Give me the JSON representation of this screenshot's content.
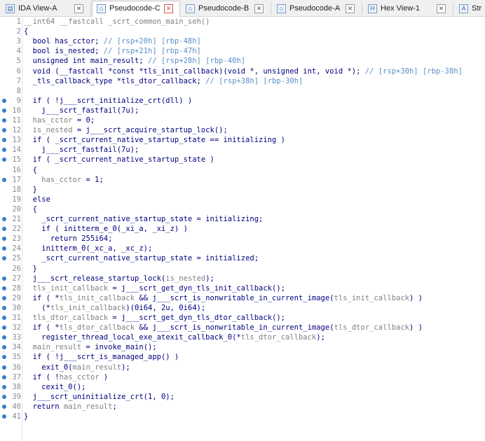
{
  "tabs": [
    {
      "label": "IDA View-A",
      "icon": "ida-view-icon",
      "active": false
    },
    {
      "label": "Pseudocode-C",
      "icon": "pseudocode-icon",
      "active": true
    },
    {
      "label": "Pseudocode-B",
      "icon": "pseudocode-icon",
      "active": false
    },
    {
      "label": "Pseudocode-A",
      "icon": "pseudocode-icon",
      "active": false
    },
    {
      "label": "Hex View-1",
      "icon": "hex-view-icon",
      "active": false
    },
    {
      "label": "Str",
      "icon": "structures-icon",
      "active": false
    }
  ],
  "close_glyph": "✕",
  "colors": {
    "code": "#000080",
    "variable": "#808080",
    "comment": "#5b8ec8",
    "line_number": "#8a8a8a",
    "breakpoint": "#2f7fd1"
  },
  "lines": [
    {
      "n": "1",
      "bp": false,
      "tokens": [
        [
          "h",
          "__int64 __fastcall _scrt_common_main_seh()"
        ]
      ]
    },
    {
      "n": "2",
      "bp": false,
      "tokens": [
        [
          "t",
          "{"
        ]
      ]
    },
    {
      "n": "3",
      "bp": false,
      "tokens": [
        [
          "t",
          "  bool has_cctor; "
        ],
        [
          "c",
          "// [rsp+20h] [rbp-48h]"
        ]
      ]
    },
    {
      "n": "4",
      "bp": false,
      "tokens": [
        [
          "t",
          "  bool is_nested; "
        ],
        [
          "c",
          "// [rsp+21h] [rbp-47h]"
        ]
      ]
    },
    {
      "n": "5",
      "bp": false,
      "tokens": [
        [
          "t",
          "  unsigned int main_result; "
        ],
        [
          "c",
          "// [rsp+28h] [rbp-40h]"
        ]
      ]
    },
    {
      "n": "6",
      "bp": false,
      "tokens": [
        [
          "t",
          "  void (__fastcall *const *tls_init_callback)(void *, unsigned int, void *); "
        ],
        [
          "c",
          "// [rsp+30h] [rbp-38h]"
        ]
      ]
    },
    {
      "n": "7",
      "bp": false,
      "tokens": [
        [
          "t",
          "  _tls_callback_type *tls_dtor_callback; "
        ],
        [
          "c",
          "// [rsp+38h] [rbp-30h]"
        ]
      ]
    },
    {
      "n": "8",
      "bp": false,
      "tokens": [
        [
          "t",
          ""
        ]
      ]
    },
    {
      "n": "9",
      "bp": true,
      "tokens": [
        [
          "t",
          "  if ( !j___scrt_initialize_crt(dll) )"
        ]
      ]
    },
    {
      "n": "10",
      "bp": true,
      "tokens": [
        [
          "t",
          "    j___scrt_fastfail(7u);"
        ]
      ]
    },
    {
      "n": "11",
      "bp": true,
      "tokens": [
        [
          "v",
          "  has_cctor"
        ],
        [
          "t",
          " = 0;"
        ]
      ]
    },
    {
      "n": "12",
      "bp": true,
      "tokens": [
        [
          "v",
          "  is_nested"
        ],
        [
          "t",
          " = j___scrt_acquire_startup_lock();"
        ]
      ]
    },
    {
      "n": "13",
      "bp": true,
      "tokens": [
        [
          "t",
          "  if ( _scrt_current_native_startup_state == initializing )"
        ]
      ]
    },
    {
      "n": "14",
      "bp": true,
      "tokens": [
        [
          "t",
          "    j___scrt_fastfail(7u);"
        ]
      ]
    },
    {
      "n": "15",
      "bp": true,
      "tokens": [
        [
          "t",
          "  if ( _scrt_current_native_startup_state )"
        ]
      ]
    },
    {
      "n": "16",
      "bp": false,
      "tokens": [
        [
          "t",
          "  {"
        ]
      ]
    },
    {
      "n": "17",
      "bp": true,
      "tokens": [
        [
          "v",
          "    has_cctor"
        ],
        [
          "t",
          " = 1;"
        ]
      ]
    },
    {
      "n": "18",
      "bp": false,
      "tokens": [
        [
          "t",
          "  }"
        ]
      ]
    },
    {
      "n": "19",
      "bp": false,
      "tokens": [
        [
          "t",
          "  else"
        ]
      ]
    },
    {
      "n": "20",
      "bp": false,
      "tokens": [
        [
          "t",
          "  {"
        ]
      ]
    },
    {
      "n": "21",
      "bp": true,
      "tokens": [
        [
          "t",
          "    _scrt_current_native_startup_state = initializing;"
        ]
      ]
    },
    {
      "n": "22",
      "bp": true,
      "tokens": [
        [
          "t",
          "    if ( initterm_e_0(_xi_a, _xi_z) )"
        ]
      ]
    },
    {
      "n": "23",
      "bp": true,
      "tokens": [
        [
          "t",
          "      return 255i64;"
        ]
      ]
    },
    {
      "n": "24",
      "bp": true,
      "tokens": [
        [
          "t",
          "    initterm_0(_xc_a, _xc_z);"
        ]
      ]
    },
    {
      "n": "25",
      "bp": true,
      "tokens": [
        [
          "t",
          "    _scrt_current_native_startup_state = initialized;"
        ]
      ]
    },
    {
      "n": "26",
      "bp": false,
      "tokens": [
        [
          "t",
          "  }"
        ]
      ]
    },
    {
      "n": "27",
      "bp": true,
      "tokens": [
        [
          "t",
          "  j___scrt_release_startup_lock("
        ],
        [
          "v",
          "is_nested"
        ],
        [
          "t",
          ");"
        ]
      ]
    },
    {
      "n": "28",
      "bp": true,
      "tokens": [
        [
          "v",
          "  tls_init_callback"
        ],
        [
          "t",
          " = j___scrt_get_dyn_tls_init_callback();"
        ]
      ]
    },
    {
      "n": "29",
      "bp": true,
      "tokens": [
        [
          "t",
          "  if ( *"
        ],
        [
          "v",
          "tls_init_callback"
        ],
        [
          "t",
          " && j___scrt_is_nonwritable_in_current_image("
        ],
        [
          "v",
          "tls_init_callback"
        ],
        [
          "t",
          ") )"
        ]
      ]
    },
    {
      "n": "30",
      "bp": true,
      "tokens": [
        [
          "t",
          "    (*"
        ],
        [
          "v",
          "tls_init_callback"
        ],
        [
          "t",
          ")(0i64, 2u, 0i64);"
        ]
      ]
    },
    {
      "n": "31",
      "bp": true,
      "tokens": [
        [
          "v",
          "  tls_dtor_callback"
        ],
        [
          "t",
          " = j___scrt_get_dyn_tls_dtor_callback();"
        ]
      ]
    },
    {
      "n": "32",
      "bp": true,
      "tokens": [
        [
          "t",
          "  if ( *"
        ],
        [
          "v",
          "tls_dtor_callback"
        ],
        [
          "t",
          " && j___scrt_is_nonwritable_in_current_image("
        ],
        [
          "v",
          "tls_dtor_callback"
        ],
        [
          "t",
          ") )"
        ]
      ]
    },
    {
      "n": "33",
      "bp": true,
      "tokens": [
        [
          "t",
          "    register_thread_local_exe_atexit_callback_0(*"
        ],
        [
          "v",
          "tls_dtor_callback"
        ],
        [
          "t",
          ");"
        ]
      ]
    },
    {
      "n": "34",
      "bp": true,
      "tokens": [
        [
          "v",
          "  main_result"
        ],
        [
          "t",
          " = invoke_main();"
        ]
      ]
    },
    {
      "n": "35",
      "bp": true,
      "tokens": [
        [
          "t",
          "  if ( !j___scrt_is_managed_app() )"
        ]
      ]
    },
    {
      "n": "36",
      "bp": true,
      "tokens": [
        [
          "t",
          "    exit_0("
        ],
        [
          "v",
          "main_result"
        ],
        [
          "t",
          ");"
        ]
      ]
    },
    {
      "n": "37",
      "bp": true,
      "tokens": [
        [
          "t",
          "  if ( !"
        ],
        [
          "v",
          "has_cctor"
        ],
        [
          "t",
          " )"
        ]
      ]
    },
    {
      "n": "38",
      "bp": true,
      "tokens": [
        [
          "t",
          "    cexit_0();"
        ]
      ]
    },
    {
      "n": "39",
      "bp": true,
      "tokens": [
        [
          "t",
          "  j___scrt_uninitialize_crt(1, 0);"
        ]
      ]
    },
    {
      "n": "40",
      "bp": true,
      "tokens": [
        [
          "t",
          "  return "
        ],
        [
          "v",
          "main_result"
        ],
        [
          "t",
          ";"
        ]
      ]
    },
    {
      "n": "41",
      "bp": true,
      "tokens": [
        [
          "t",
          "}"
        ]
      ]
    }
  ]
}
